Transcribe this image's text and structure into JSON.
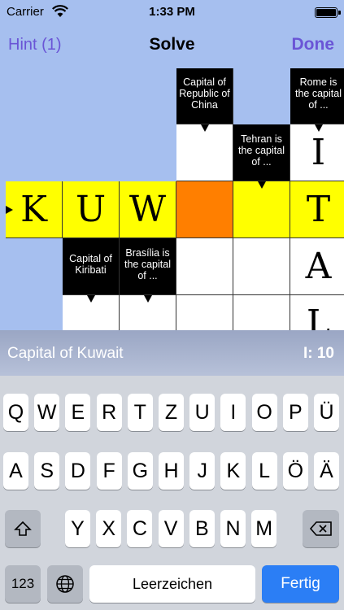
{
  "status_bar": {
    "carrier": "Carrier",
    "time": "1:33 PM"
  },
  "nav_bar": {
    "hint_label": "Hint (1)",
    "title": "Solve",
    "done_label": "Done"
  },
  "grid": {
    "clues": {
      "taiwan": "Capital of Republic of China",
      "rome": "Rome is the capital of ...",
      "tehran": "Tehran is the capital of ...",
      "kiribati": "Capital of Kiribati",
      "brasilia": "Brasília is the capital of ..."
    },
    "letters": {
      "r3c0": "K",
      "r3c1": "U",
      "r3c2": "W",
      "r3c5": "T",
      "r2c5": "I",
      "r4c5": "A",
      "r5c5": "L"
    }
  },
  "clue_bar": {
    "text": "Capital of Kuwait",
    "id": "I: 10"
  },
  "keyboard": {
    "row1": [
      "Q",
      "W",
      "E",
      "R",
      "T",
      "Z",
      "U",
      "I",
      "O",
      "P",
      "Ü"
    ],
    "row2": [
      "A",
      "S",
      "D",
      "F",
      "G",
      "H",
      "J",
      "K",
      "L",
      "Ö",
      "Ä"
    ],
    "row3": [
      "Y",
      "X",
      "C",
      "V",
      "B",
      "N",
      "M"
    ],
    "numbers_label": "123",
    "space_label": "Leerzeichen",
    "return_label": "Fertig"
  },
  "colors": {
    "accent": "#6a55d6",
    "highlight_word": "#ffff00",
    "active_cell": "#ff7f00",
    "grid_background": "#a6bfef",
    "return_key": "#2b7ef5"
  }
}
